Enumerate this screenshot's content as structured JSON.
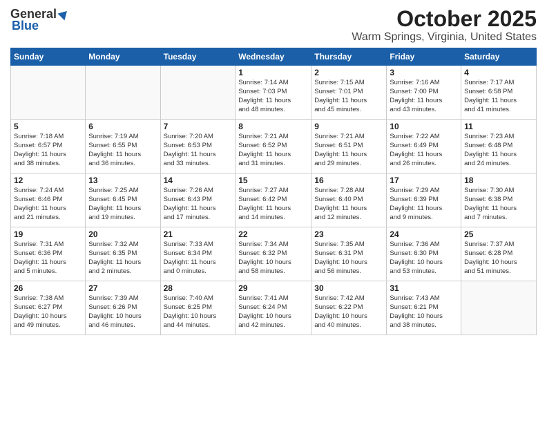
{
  "logo": {
    "general": "General",
    "blue": "Blue"
  },
  "header": {
    "month": "October 2025",
    "location": "Warm Springs, Virginia, United States"
  },
  "days_of_week": [
    "Sunday",
    "Monday",
    "Tuesday",
    "Wednesday",
    "Thursday",
    "Friday",
    "Saturday"
  ],
  "weeks": [
    [
      {
        "day": "",
        "info": ""
      },
      {
        "day": "",
        "info": ""
      },
      {
        "day": "",
        "info": ""
      },
      {
        "day": "1",
        "info": "Sunrise: 7:14 AM\nSunset: 7:03 PM\nDaylight: 11 hours\nand 48 minutes."
      },
      {
        "day": "2",
        "info": "Sunrise: 7:15 AM\nSunset: 7:01 PM\nDaylight: 11 hours\nand 45 minutes."
      },
      {
        "day": "3",
        "info": "Sunrise: 7:16 AM\nSunset: 7:00 PM\nDaylight: 11 hours\nand 43 minutes."
      },
      {
        "day": "4",
        "info": "Sunrise: 7:17 AM\nSunset: 6:58 PM\nDaylight: 11 hours\nand 41 minutes."
      }
    ],
    [
      {
        "day": "5",
        "info": "Sunrise: 7:18 AM\nSunset: 6:57 PM\nDaylight: 11 hours\nand 38 minutes."
      },
      {
        "day": "6",
        "info": "Sunrise: 7:19 AM\nSunset: 6:55 PM\nDaylight: 11 hours\nand 36 minutes."
      },
      {
        "day": "7",
        "info": "Sunrise: 7:20 AM\nSunset: 6:53 PM\nDaylight: 11 hours\nand 33 minutes."
      },
      {
        "day": "8",
        "info": "Sunrise: 7:21 AM\nSunset: 6:52 PM\nDaylight: 11 hours\nand 31 minutes."
      },
      {
        "day": "9",
        "info": "Sunrise: 7:21 AM\nSunset: 6:51 PM\nDaylight: 11 hours\nand 29 minutes."
      },
      {
        "day": "10",
        "info": "Sunrise: 7:22 AM\nSunset: 6:49 PM\nDaylight: 11 hours\nand 26 minutes."
      },
      {
        "day": "11",
        "info": "Sunrise: 7:23 AM\nSunset: 6:48 PM\nDaylight: 11 hours\nand 24 minutes."
      }
    ],
    [
      {
        "day": "12",
        "info": "Sunrise: 7:24 AM\nSunset: 6:46 PM\nDaylight: 11 hours\nand 21 minutes."
      },
      {
        "day": "13",
        "info": "Sunrise: 7:25 AM\nSunset: 6:45 PM\nDaylight: 11 hours\nand 19 minutes."
      },
      {
        "day": "14",
        "info": "Sunrise: 7:26 AM\nSunset: 6:43 PM\nDaylight: 11 hours\nand 17 minutes."
      },
      {
        "day": "15",
        "info": "Sunrise: 7:27 AM\nSunset: 6:42 PM\nDaylight: 11 hours\nand 14 minutes."
      },
      {
        "day": "16",
        "info": "Sunrise: 7:28 AM\nSunset: 6:40 PM\nDaylight: 11 hours\nand 12 minutes."
      },
      {
        "day": "17",
        "info": "Sunrise: 7:29 AM\nSunset: 6:39 PM\nDaylight: 11 hours\nand 9 minutes."
      },
      {
        "day": "18",
        "info": "Sunrise: 7:30 AM\nSunset: 6:38 PM\nDaylight: 11 hours\nand 7 minutes."
      }
    ],
    [
      {
        "day": "19",
        "info": "Sunrise: 7:31 AM\nSunset: 6:36 PM\nDaylight: 11 hours\nand 5 minutes."
      },
      {
        "day": "20",
        "info": "Sunrise: 7:32 AM\nSunset: 6:35 PM\nDaylight: 11 hours\nand 2 minutes."
      },
      {
        "day": "21",
        "info": "Sunrise: 7:33 AM\nSunset: 6:34 PM\nDaylight: 11 hours\nand 0 minutes."
      },
      {
        "day": "22",
        "info": "Sunrise: 7:34 AM\nSunset: 6:32 PM\nDaylight: 10 hours\nand 58 minutes."
      },
      {
        "day": "23",
        "info": "Sunrise: 7:35 AM\nSunset: 6:31 PM\nDaylight: 10 hours\nand 56 minutes."
      },
      {
        "day": "24",
        "info": "Sunrise: 7:36 AM\nSunset: 6:30 PM\nDaylight: 10 hours\nand 53 minutes."
      },
      {
        "day": "25",
        "info": "Sunrise: 7:37 AM\nSunset: 6:28 PM\nDaylight: 10 hours\nand 51 minutes."
      }
    ],
    [
      {
        "day": "26",
        "info": "Sunrise: 7:38 AM\nSunset: 6:27 PM\nDaylight: 10 hours\nand 49 minutes."
      },
      {
        "day": "27",
        "info": "Sunrise: 7:39 AM\nSunset: 6:26 PM\nDaylight: 10 hours\nand 46 minutes."
      },
      {
        "day": "28",
        "info": "Sunrise: 7:40 AM\nSunset: 6:25 PM\nDaylight: 10 hours\nand 44 minutes."
      },
      {
        "day": "29",
        "info": "Sunrise: 7:41 AM\nSunset: 6:24 PM\nDaylight: 10 hours\nand 42 minutes."
      },
      {
        "day": "30",
        "info": "Sunrise: 7:42 AM\nSunset: 6:22 PM\nDaylight: 10 hours\nand 40 minutes."
      },
      {
        "day": "31",
        "info": "Sunrise: 7:43 AM\nSunset: 6:21 PM\nDaylight: 10 hours\nand 38 minutes."
      },
      {
        "day": "",
        "info": ""
      }
    ]
  ]
}
